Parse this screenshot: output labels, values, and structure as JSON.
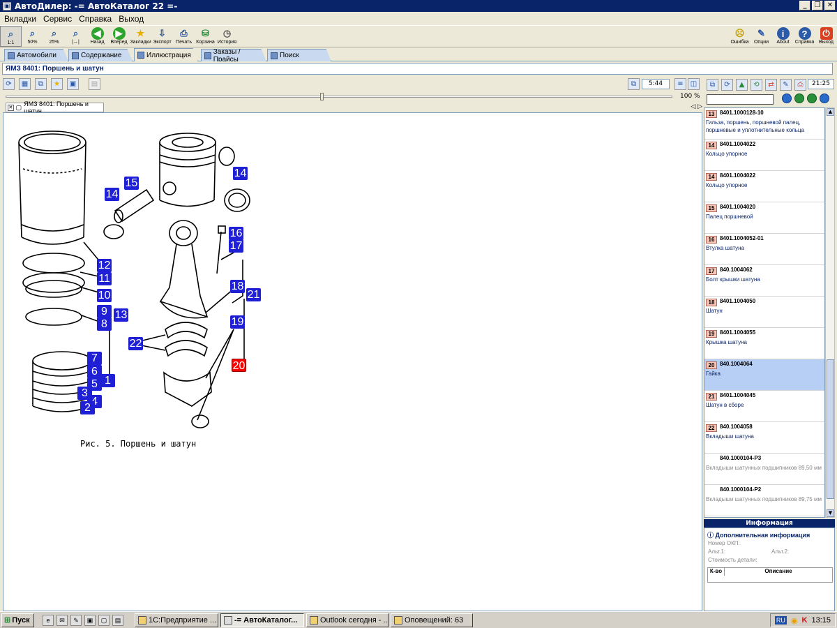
{
  "window": {
    "title": "АвтоДилер: -= АвтоКаталог 22 =-"
  },
  "menu": [
    "Вкладки",
    "Сервис",
    "Справка",
    "Выход"
  ],
  "toolbar": {
    "left": [
      {
        "label": "1:1",
        "icon": "zoom-1-1-icon"
      },
      {
        "label": "50%",
        "icon": "zoom-50-icon"
      },
      {
        "label": "25%",
        "icon": "zoom-25-icon"
      },
      {
        "label": "",
        "icon": "zoom-width-icon"
      },
      {
        "label": "Назад",
        "icon": "back-icon"
      },
      {
        "label": "Вперед",
        "icon": "forward-icon"
      },
      {
        "label": "Закладки",
        "icon": "bookmarks-icon"
      },
      {
        "label": "Экспорт",
        "icon": "export-icon"
      },
      {
        "label": "Печать",
        "icon": "print-icon"
      },
      {
        "label": "Корзина",
        "icon": "cart-icon"
      },
      {
        "label": "История",
        "icon": "history-icon"
      }
    ],
    "right": [
      {
        "label": "Ошибка",
        "icon": "error-icon"
      },
      {
        "label": "Опции",
        "icon": "options-icon"
      },
      {
        "label": "About",
        "icon": "about-icon"
      },
      {
        "label": "Справка",
        "icon": "help-icon"
      },
      {
        "label": "Выход",
        "icon": "exit-icon"
      }
    ]
  },
  "tabs": [
    "Автомобили",
    "Содержание",
    "Иллюстрация",
    "Заказы / Прайсы",
    "Поиск"
  ],
  "active_tab": "Иллюстрация",
  "breadcrumb": "ЯМЗ 8401: Поршень и шатун",
  "page_indicator": "5:44",
  "zoom": "100 %",
  "zoom_value_percent": 100,
  "doc_tab": "ЯМЗ 8401: Поршень и шатун",
  "doc_tab_arrows": "◁ ▷",
  "illustration": {
    "caption": "Рис. 5. Поршень и шатун",
    "callouts": [
      "14",
      "15",
      "14",
      "16",
      "17",
      "12",
      "11",
      "10",
      "9",
      "13",
      "8",
      "18",
      "21",
      "19",
      "22",
      "20",
      "7",
      "6",
      "5",
      "1",
      "3",
      "4",
      "2"
    ],
    "highlighted": "20"
  },
  "right_panel": {
    "time": "21:25",
    "parts": [
      {
        "num": "13",
        "code": "8401.1000128-10",
        "desc": "Гильза, поршень, поршневой палец, поршневые и уплотнительные кольца"
      },
      {
        "num": "14",
        "code": "8401.1004022",
        "desc": "Кольцо упорное"
      },
      {
        "num": "14",
        "code": "8401.1004022",
        "desc": "Кольцо упорное"
      },
      {
        "num": "15",
        "code": "8401.1004020",
        "desc": "Палец поршневой"
      },
      {
        "num": "16",
        "code": "8401.1004052-01",
        "desc": "Втулка шатуна"
      },
      {
        "num": "17",
        "code": "840.1004062",
        "desc": "Болт крышки шатуна"
      },
      {
        "num": "18",
        "code": "8401.1004050",
        "desc": "Шатун"
      },
      {
        "num": "19",
        "code": "8401.1004055",
        "desc": "Крышка шатуна"
      },
      {
        "num": "20",
        "code": "840.1004064",
        "desc": "Гайка"
      },
      {
        "num": "21",
        "code": "8401.1004045",
        "desc": "Шатун в сборе"
      },
      {
        "num": "22",
        "code": "840.1004058",
        "desc": "Вкладыши шатуна"
      },
      {
        "num": "",
        "code": "840.1000104-Р3",
        "desc": "Вкладыши шатунных подшипников 89,50 мм"
      },
      {
        "num": "",
        "code": "840.1000104-Р2",
        "desc": "Вкладыши шатунных подшипников 89,75 мм"
      }
    ],
    "selected_num": "20",
    "info": {
      "header": "Информация",
      "title": "Дополнительная информация",
      "okp": "Номер ОКП:",
      "alt1": "Альт.1:",
      "alt2": "Альт.2:",
      "cost": "Стоимость детали:",
      "col1": "К-во",
      "col2": "Описание"
    }
  },
  "taskbar": {
    "start": "Пуск",
    "tasks": [
      "1С:Предприятие ...",
      "-= АвтоКаталог...",
      "Outlook сегодня - ...",
      "Оповещений: 63"
    ],
    "lang": "RU",
    "clock": "13:15"
  }
}
